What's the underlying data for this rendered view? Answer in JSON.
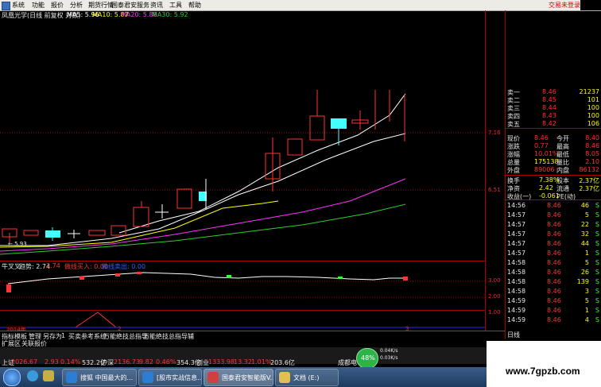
{
  "menu": {
    "items": [
      "系统",
      "功能",
      "报价",
      "分析",
      "期货行情",
      "国泰君安服务",
      "资讯",
      "工具",
      "帮助"
    ],
    "not_logged_in": "交易未登录"
  },
  "main_chart": {
    "title": "凤凰光学(日线 前复权 对数)",
    "ma5_label": "MA5: 5.96",
    "ma10_label": "MA10: 5.87",
    "ma20_label": "MA20: 5.88",
    "ma30_label": "MA30: 5.92",
    "low_marker": "← 5.93",
    "colors": {
      "ma5": "#ffffff",
      "ma10": "#ffff00",
      "ma20": "#ff33ff",
      "ma30": "#33cc33",
      "up": "#ff3333",
      "down": "#44ffff"
    }
  },
  "sub_chart": {
    "title": "牛叉叉",
    "trend_label": "趋势: 2.74",
    "trend_value2": "2.74",
    "buy_label": "做线买入: 0.00",
    "sell_label": "做线卖出: 0.00"
  },
  "vol_chart": {
    "year_label": "2014年",
    "month_a": "2",
    "month_b": "3"
  },
  "axis": {
    "ticks": [
      "7.16",
      "6.51",
      "3.00",
      "2.00",
      "1.00"
    ]
  },
  "quote": {
    "sell_rows": [
      {
        "label": "卖一",
        "price": "8.46",
        "vol": "21237"
      },
      {
        "label": "卖二",
        "price": "8.45",
        "vol": "101"
      },
      {
        "label": "卖三",
        "price": "8.44",
        "vol": "100"
      },
      {
        "label": "卖四",
        "price": "8.43",
        "vol": "100"
      },
      {
        "label": "卖五",
        "price": "8.42",
        "vol": "106"
      }
    ],
    "stats": [
      {
        "l1": "现价",
        "v1": "8.46",
        "l2": "今开",
        "v2": "8.40"
      },
      {
        "l1": "涨跌",
        "v1": "0.77",
        "l2": "最高",
        "v2": "8.46"
      },
      {
        "l1": "涨幅",
        "v1": "10.01%",
        "l2": "最低",
        "v2": "8.05"
      },
      {
        "l1": "总量",
        "v1": "175138",
        "l2": "量比",
        "v2": "2.10"
      },
      {
        "l1": "外盘",
        "v1": "89006",
        "l2": "内盘",
        "v2": "86132"
      }
    ],
    "stats2": [
      {
        "l1": "换手",
        "v1": "7.38%",
        "l2": "股本",
        "v2": "2.37亿"
      },
      {
        "l1": "净资",
        "v1": "2.42",
        "l2": "流通",
        "v2": "2.37亿"
      },
      {
        "l1": "收益(一)",
        "v1": "-0.061",
        "l2": "PE(动)",
        "v2": ""
      }
    ],
    "ticks": [
      {
        "time": "14:56",
        "price": "8.46",
        "vol": "46",
        "side": "S"
      },
      {
        "time": "14:57",
        "price": "8.46",
        "vol": "5",
        "side": "S"
      },
      {
        "time": "14:57",
        "price": "8.46",
        "vol": "22",
        "side": "S"
      },
      {
        "time": "14:57",
        "price": "8.46",
        "vol": "32",
        "side": "S"
      },
      {
        "time": "14:57",
        "price": "8.46",
        "vol": "44",
        "side": "S"
      },
      {
        "time": "14:57",
        "price": "8.46",
        "vol": "1",
        "side": "S"
      },
      {
        "time": "14:58",
        "price": "8.46",
        "vol": "5",
        "side": "S"
      },
      {
        "time": "14:58",
        "price": "8.46",
        "vol": "26",
        "side": "S"
      },
      {
        "time": "14:58",
        "price": "8.46",
        "vol": "139",
        "side": "S"
      },
      {
        "time": "14:58",
        "price": "8.46",
        "vol": "3",
        "side": "S"
      },
      {
        "time": "14:59",
        "price": "8.46",
        "vol": "5",
        "side": "S"
      },
      {
        "time": "14:59",
        "price": "8.46",
        "vol": "1",
        "side": "S"
      },
      {
        "time": "14:59",
        "price": "8.46",
        "vol": "4",
        "side": "S"
      }
    ],
    "bottom_tab": "日线"
  },
  "toolbar1": {
    "items": [
      "指标",
      "模板",
      "管理",
      "另存为",
      "1",
      "买卖参考系统",
      "万能绝技总指导",
      "万能绝技总指导辅"
    ]
  },
  "toolbar2": {
    "items": [
      "扩展区",
      "关联报价"
    ]
  },
  "status": {
    "sh_label": "上证",
    "sh_index": "2026.67",
    "sh_change": "2.93",
    "sh_pct": "0.14%",
    "sh_amount": "532.2亿",
    "sz_label": "沪深",
    "sz_index": "2136.73",
    "sz_change": "9.82",
    "sz_pct": "0.46%",
    "sz_amount": "354.3亿",
    "cy_label": "创业",
    "cy_index": "1333.98",
    "cy_change": "13.32",
    "cy_pct": "1.01%",
    "cy_amount": "203.6亿",
    "extra": "成都电",
    "net_pct": "48%",
    "net_up": "0.04K/s",
    "net_down": "0.03K/s"
  },
  "taskbar": {
    "buttons": [
      {
        "label": "搜狐 中国最大的...",
        "color": "#2a7fd4"
      },
      {
        "label": "[股市实战信息...",
        "color": "#2a7fd4"
      },
      {
        "label": "国泰君安智能版V...",
        "color": "#d04040"
      },
      {
        "label": "文档 (E:)",
        "color": "#e0c050"
      }
    ]
  },
  "watermark": "www.7gpzb.com"
}
